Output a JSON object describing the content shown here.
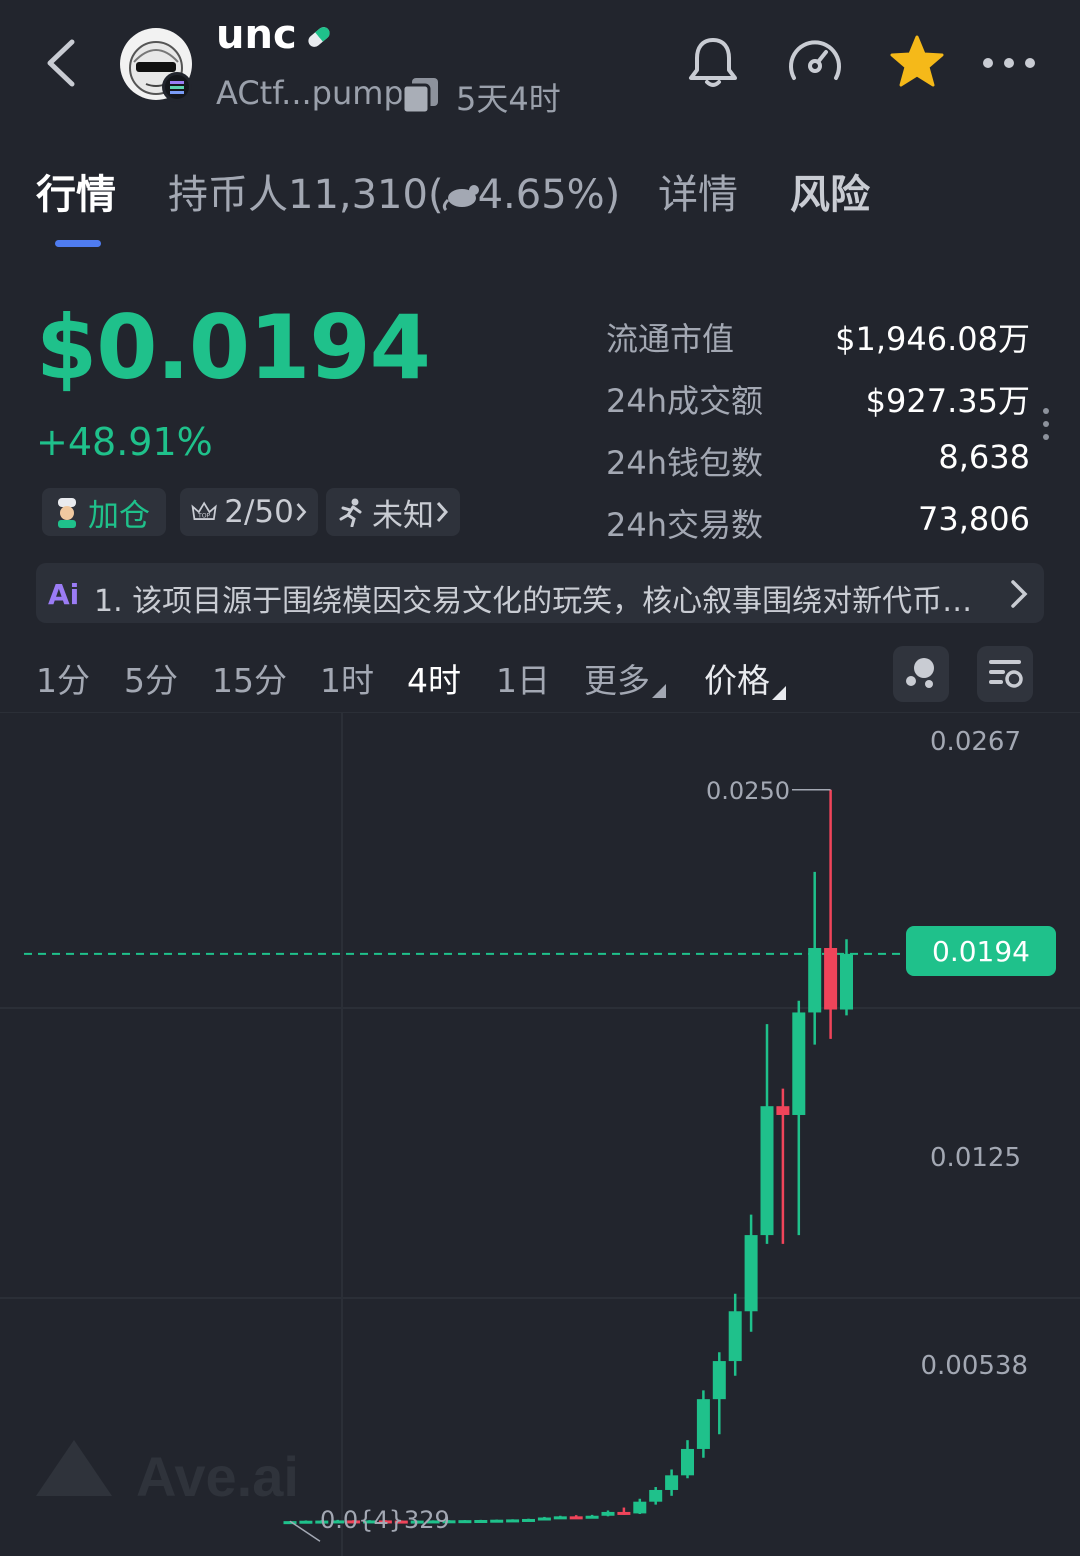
{
  "header": {
    "token_name": "unc",
    "address": "ACtf...pump",
    "age": "5天4时"
  },
  "tabs": [
    {
      "label": "行情",
      "active": true
    },
    {
      "label": "持币人11,310(",
      "suffix": "4.65%)"
    },
    {
      "label": "详情"
    },
    {
      "label": "风险"
    }
  ],
  "price": {
    "value": "$0.0194",
    "change": "+48.91%",
    "color": "#1fc18b"
  },
  "chips": [
    {
      "label": "加仓",
      "icon": "chef-icon"
    },
    {
      "label": "2/50",
      "icon": "top-crown-icon"
    },
    {
      "label": "未知",
      "icon": "runner-icon"
    }
  ],
  "stats": [
    {
      "label": "流通市值",
      "value": "$1,946.08万"
    },
    {
      "label": "24h成交额",
      "value": "$927.35万"
    },
    {
      "label": "24h钱包数",
      "value": "8,638"
    },
    {
      "label": "24h交易数",
      "value": "73,806"
    }
  ],
  "ai_summary": {
    "badge": "Ai",
    "text": "1. 该项目源于围绕模因交易文化的玩笑，核心叙事围绕对新代币…"
  },
  "timeframes": [
    "1分",
    "5分",
    "15分",
    "1时",
    "4时",
    "1日",
    "更多",
    "价格"
  ],
  "active_timeframe": "4时",
  "chart_data": {
    "type": "candlestick",
    "y_axis_labels": [
      "0.0267",
      "0.0125",
      "0.00538"
    ],
    "high_label": "0.0250",
    "low_label": "0.0{4}329",
    "current_price_label": "0.0194",
    "watermark": "Ave.ai",
    "up_color": "#1fc18b",
    "down_color": "#f0445a",
    "candles": [
      {
        "o": 3.29e-05,
        "h": 4e-05,
        "l": 3e-05,
        "c": 3.6e-05
      },
      {
        "o": 3.6e-05,
        "h": 6e-05,
        "l": 3.4e-05,
        "c": 5e-05
      },
      {
        "o": 5e-05,
        "h": 7e-05,
        "l": 4.5e-05,
        "c": 5.5e-05
      },
      {
        "o": 5.5e-05,
        "h": 8e-05,
        "l": 5e-05,
        "c": 6e-05
      },
      {
        "o": 6e-05,
        "h": 7e-05,
        "l": 5e-05,
        "c": 5.2e-05
      },
      {
        "o": 5.2e-05,
        "h": 7e-05,
        "l": 4.5e-05,
        "c": 6e-05
      },
      {
        "o": 6e-05,
        "h": 7e-05,
        "l": 5e-05,
        "c": 5.5e-05
      },
      {
        "o": 5.5e-05,
        "h": 6.2e-05,
        "l": 4.5e-05,
        "c": 5e-05
      },
      {
        "o": 5e-05,
        "h": 6e-05,
        "l": 4.5e-05,
        "c": 5.5e-05
      },
      {
        "o": 5.5e-05,
        "h": 6.5e-05,
        "l": 5e-05,
        "c": 6e-05
      },
      {
        "o": 6e-05,
        "h": 7e-05,
        "l": 5.5e-05,
        "c": 6.5e-05
      },
      {
        "o": 6.5e-05,
        "h": 7.5e-05,
        "l": 6e-05,
        "c": 7e-05
      },
      {
        "o": 7e-05,
        "h": 8e-05,
        "l": 6.5e-05,
        "c": 7.5e-05
      },
      {
        "o": 7.5e-05,
        "h": 9e-05,
        "l": 7e-05,
        "c": 8.5e-05
      },
      {
        "o": 8.5e-05,
        "h": 0.0001,
        "l": 8e-05,
        "c": 9.5e-05
      },
      {
        "o": 9.5e-05,
        "h": 0.00012,
        "l": 9e-05,
        "c": 0.00011
      },
      {
        "o": 0.00011,
        "h": 0.00018,
        "l": 0.0001,
        "c": 0.00016
      },
      {
        "o": 0.00016,
        "h": 0.00022,
        "l": 0.00015,
        "c": 0.0002
      },
      {
        "o": 0.0002,
        "h": 0.00024,
        "l": 0.00012,
        "c": 0.00016
      },
      {
        "o": 0.00016,
        "h": 0.00025,
        "l": 0.00014,
        "c": 0.00022
      },
      {
        "o": 0.00022,
        "h": 0.0004,
        "l": 0.0002,
        "c": 0.00035
      },
      {
        "o": 0.00035,
        "h": 0.0005,
        "l": 0.00025,
        "c": 0.0003
      },
      {
        "o": 0.0003,
        "h": 0.0008,
        "l": 0.00028,
        "c": 0.0007
      },
      {
        "o": 0.0007,
        "h": 0.0012,
        "l": 0.0006,
        "c": 0.0011
      },
      {
        "o": 0.0011,
        "h": 0.0018,
        "l": 0.0009,
        "c": 0.0016
      },
      {
        "o": 0.0016,
        "h": 0.0028,
        "l": 0.0015,
        "c": 0.0025
      },
      {
        "o": 0.0025,
        "h": 0.0045,
        "l": 0.0022,
        "c": 0.0042
      },
      {
        "o": 0.0042,
        "h": 0.0058,
        "l": 0.003,
        "c": 0.0055
      },
      {
        "o": 0.0055,
        "h": 0.0078,
        "l": 0.005,
        "c": 0.0072
      },
      {
        "o": 0.0072,
        "h": 0.0105,
        "l": 0.0065,
        "c": 0.0098
      },
      {
        "o": 0.0098,
        "h": 0.017,
        "l": 0.0095,
        "c": 0.0142
      },
      {
        "o": 0.0142,
        "h": 0.0148,
        "l": 0.0095,
        "c": 0.0139
      },
      {
        "o": 0.0139,
        "h": 0.0178,
        "l": 0.0098,
        "c": 0.0174
      },
      {
        "o": 0.0174,
        "h": 0.0222,
        "l": 0.0163,
        "c": 0.0196
      },
      {
        "o": 0.0196,
        "h": 0.025,
        "l": 0.0165,
        "c": 0.0175
      },
      {
        "o": 0.0175,
        "h": 0.0199,
        "l": 0.0173,
        "c": 0.0194
      }
    ]
  }
}
